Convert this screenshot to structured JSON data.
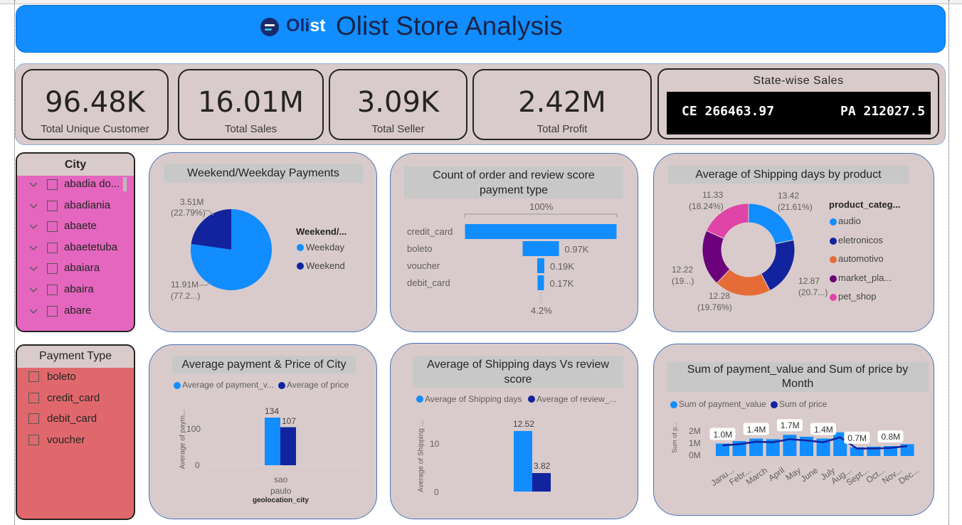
{
  "header": {
    "logo_text_main": "Oli",
    "logo_text_accent": "st",
    "title": "Olist Store Analysis"
  },
  "colors": {
    "accent": "#118dff",
    "dark_blue": "#12239e",
    "orange": "#e66c37",
    "purple": "#6b007b",
    "pink": "#e044a7",
    "panel_bg": "#d9cbcb"
  },
  "kpis": [
    {
      "value": "96.48K",
      "label": "Total Unique Customer"
    },
    {
      "value": "16.01M",
      "label": "Total Sales"
    },
    {
      "value": "3.09K",
      "label": "Total Seller"
    },
    {
      "value": "2.42M",
      "label": "Total Profit"
    }
  ],
  "state_sales": {
    "title": "State-wise Sales",
    "items": [
      "CE 266463.97",
      "PA 212027.5"
    ]
  },
  "city_slicer": {
    "title": "City",
    "items": [
      "abadia do...",
      "abadiania",
      "abaete",
      "abaetetuba",
      "abaiara",
      "abaira",
      "abare"
    ]
  },
  "payment_slicer": {
    "title": "Payment Type",
    "items": [
      "boleto",
      "credit_card",
      "debit_card",
      "voucher"
    ]
  },
  "weekend_chart": {
    "title": "Weekend/Weekday Payments",
    "legend_title": "Weekend/...",
    "slice_labels": [
      "11.91M",
      "(77.2...)",
      "3.51M",
      "(22.79%)"
    ]
  },
  "funnel_chart": {
    "title_line1": "Count of order and review score",
    "title_line2": "payment type",
    "top_label": "100%",
    "bottom_label": "4.2%",
    "value_labels": [
      "",
      "0.97K",
      "0.19K",
      "0.17K"
    ]
  },
  "donut_chart": {
    "title": "Average of Shipping days by product",
    "legend_title": "product_categ...",
    "legend_items": [
      "audio",
      "eletronicos",
      "automotivo",
      "market_pla...",
      "pet_shop"
    ],
    "label_lines": [
      "13.42",
      "(21.61%)",
      "12.87",
      "(20.7...)",
      "12.28",
      "(19.76%)",
      "12.22",
      "(19...)",
      "11.33",
      "(18.24%)"
    ]
  },
  "city_bar_chart": {
    "title": "Average payment & Price of City",
    "legend": [
      "Average of payment_v...",
      "Average of price"
    ],
    "ylabel": "Average of paym...",
    "xlabel": "geolocation_city",
    "category_lines": [
      "sao",
      "paulo"
    ],
    "y_ticks": [
      "100",
      "0"
    ],
    "value_labels": [
      "134",
      "107"
    ]
  },
  "review_bar_chart": {
    "title_line1": "Average of Shipping days Vs review",
    "title_line2": "score",
    "legend": [
      "Average of Shipping days",
      "Average of review_..."
    ],
    "ylabel": "Average of Shipping ...",
    "y_ticks": [
      "10",
      "0"
    ],
    "value_labels": [
      "12.52",
      "3.82"
    ]
  },
  "monthly_chart": {
    "title_line1": "Sum of payment_value and Sum of price by",
    "title_line2": "Month",
    "legend": [
      "Sum of payment_value",
      "Sum of price"
    ],
    "ylabel": "Sum of p...",
    "y_ticks": [
      "2M",
      "1M",
      "0M"
    ],
    "months": [
      "Janu...",
      "Febr...",
      "March",
      "April",
      "May",
      "June",
      "July",
      "Aug...",
      "Sept...",
      "Oct...",
      "Nov...",
      "Dec..."
    ],
    "data_labels": [
      "1.0M",
      "1.4M",
      "1.7M",
      "1.4M",
      "0.7M",
      "0.8M"
    ]
  },
  "chart_data": [
    {
      "type": "pie",
      "title": "Weekend/Weekday Payments",
      "categories": [
        "Weekday",
        "Weekend"
      ],
      "values": [
        11.91,
        3.51
      ],
      "unit": "M",
      "percent": [
        77.2,
        22.79
      ]
    },
    {
      "type": "bar",
      "title": "Count of order and review score payment type",
      "categories": [
        "credit_card",
        "boleto",
        "voucher",
        "debit_card"
      ],
      "values": [
        4.05,
        0.97,
        0.19,
        0.17
      ],
      "unit": "K"
    },
    {
      "type": "pie",
      "title": "Average of Shipping days by product",
      "categories": [
        "audio",
        "eletronicos",
        "automotivo",
        "market_pla...",
        "pet_shop"
      ],
      "values": [
        13.42,
        12.87,
        12.28,
        12.22,
        11.33
      ]
    },
    {
      "type": "bar",
      "title": "Average payment & Price of City",
      "categories": [
        "sao paulo"
      ],
      "series": [
        {
          "name": "Average of payment_v...",
          "values": [
            134
          ]
        },
        {
          "name": "Average of price",
          "values": [
            107
          ]
        }
      ],
      "ylim": [
        0,
        150
      ]
    },
    {
      "type": "bar",
      "title": "Average of Shipping days Vs review score",
      "categories": [
        ""
      ],
      "series": [
        {
          "name": "Average of Shipping days",
          "values": [
            12.52
          ]
        },
        {
          "name": "Average of review_...",
          "values": [
            3.82
          ]
        }
      ],
      "ylim": [
        0,
        15
      ]
    },
    {
      "type": "bar",
      "title": "Sum of payment_value and Sum of price by Month",
      "categories": [
        "January",
        "February",
        "March",
        "April",
        "May",
        "June",
        "July",
        "August",
        "September",
        "October",
        "November",
        "December"
      ],
      "series": [
        {
          "name": "Sum of payment_value",
          "values": [
            1.0,
            1.2,
            1.4,
            1.35,
            1.7,
            1.55,
            1.4,
            1.9,
            0.7,
            0.75,
            0.8,
            0.95
          ]
        },
        {
          "name": "Sum of price",
          "values": [
            0.85,
            0.95,
            1.15,
            1.1,
            1.35,
            1.25,
            1.1,
            1.5,
            0.6,
            0.6,
            0.65,
            0.8
          ]
        }
      ],
      "ylim": [
        0,
        2.2
      ],
      "unit": "M"
    }
  ]
}
